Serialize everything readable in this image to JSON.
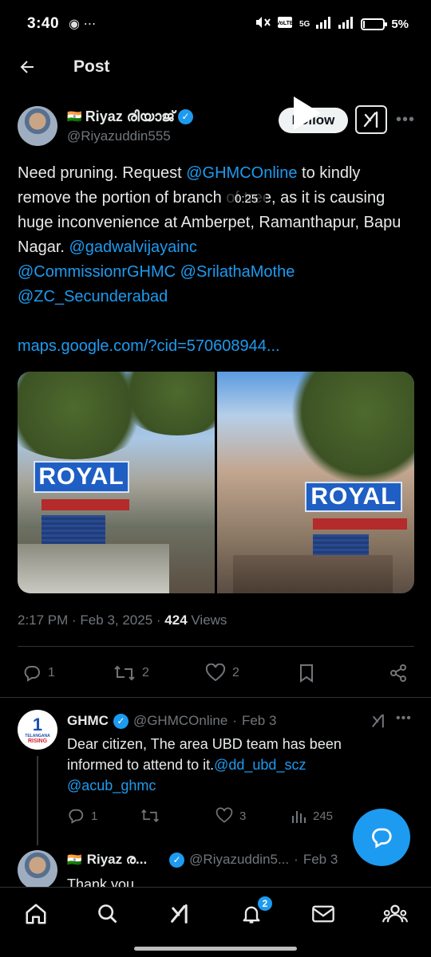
{
  "status_bar": {
    "time": "3:40",
    "battery": "5%",
    "battery_level": 0.05,
    "network": "5G"
  },
  "header": {
    "title": "Post"
  },
  "post": {
    "author": {
      "flag": "🇮🇳",
      "display_name": "Riyaz രിയാജ്",
      "handle": "@Riyazuddin555"
    },
    "follow_label": "Follow",
    "text": {
      "part1": "Need pruning. Request ",
      "mention1": "@GHMCOnline",
      "part2": " to kindly remove the portion of branch of tree, as it is causing huge inconvenience at Amberpet, Ramanthapur, Bapu Nagar. ",
      "mention2": "@gadwalvijayainc",
      "mention3": "@CommissionrGHMC",
      "mention4": "@SrilathaMothe",
      "mention5": "@ZC_Secunderabad",
      "link": "maps.google.com/?cid=570608944..."
    },
    "media": {
      "sign_text": "ROYAL",
      "video_duration": "0:25"
    },
    "meta": {
      "time": "2:17 PM",
      "date": "Feb 3, 2025",
      "views_count": "424",
      "views_label": "Views"
    },
    "actions": {
      "replies": "1",
      "reposts": "2",
      "likes": "2"
    }
  },
  "replies": [
    {
      "display_name": "GHMC",
      "handle": "@GHMCOnline",
      "date": "Feb 3",
      "avatar_text": "1",
      "avatar_line1": "TELANGANA",
      "avatar_line2": "RISING",
      "text": "Dear citizen, The area UBD team has been informed to attend to it.",
      "mention1": "@dd_ubd_scz",
      "mention2": "@acub_ghmc",
      "replies": "1",
      "reposts": "",
      "likes": "3",
      "views": "245"
    },
    {
      "flag": "🇮🇳",
      "display_name": "Riyaz ര...",
      "handle": "@Riyazuddin5...",
      "date": "Feb 3",
      "text": "Thank you."
    }
  ],
  "bottom_nav": {
    "notification_count": "2"
  },
  "colors": {
    "accent": "#1d9bf0",
    "background": "#000000",
    "text_primary": "#e7e9ea",
    "text_secondary": "#71767b"
  }
}
